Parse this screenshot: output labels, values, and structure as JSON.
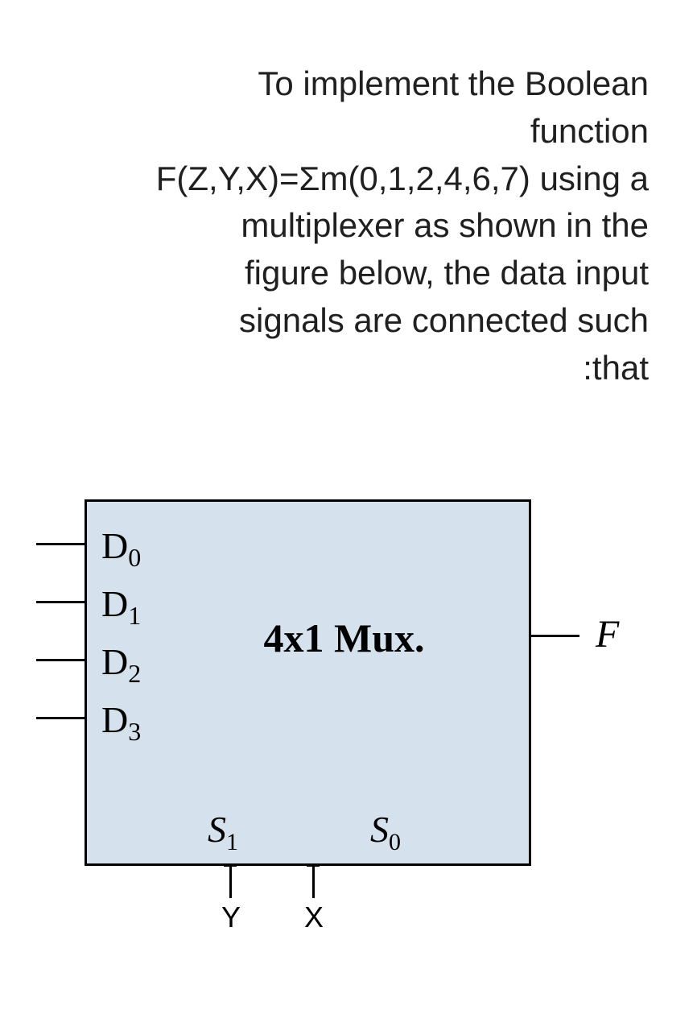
{
  "question": {
    "line1": "To implement the Boolean",
    "line2": "function",
    "line3": "F(Z,Y,X)=Σm(0,1,2,4,6,7) using a",
    "line4": "multiplexer as shown in the",
    "line5": "figure below, the  data input",
    "line6": "signals are connected such",
    "line7": ":that"
  },
  "mux": {
    "title": "4x1 Mux.",
    "data_inputs": [
      "D",
      "D",
      "D",
      "D"
    ],
    "data_subs": [
      "0",
      "1",
      "2",
      "3"
    ],
    "select_labels": [
      "S",
      "S"
    ],
    "select_subs": [
      "1",
      "0"
    ],
    "select_inputs": [
      "Y",
      "X"
    ],
    "output_label": "F"
  }
}
